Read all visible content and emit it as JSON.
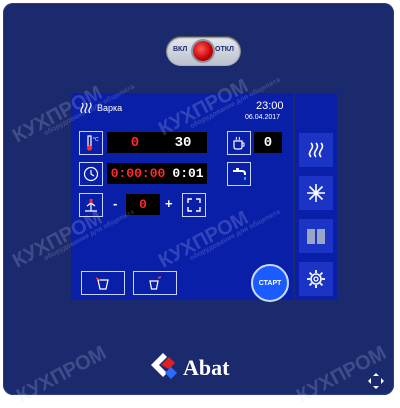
{
  "power": {
    "on_label": "ВКЛ",
    "off_label": "ОТКЛ"
  },
  "header": {
    "mode_label": "Варка",
    "time": "23:00",
    "date": "06.04.2017"
  },
  "temperature": {
    "current": "0",
    "target": "30"
  },
  "humidity": {
    "value": "0"
  },
  "timer": {
    "elapsed": "0:00:00",
    "set": "0:01"
  },
  "fan": {
    "minus": "-",
    "value": "0",
    "plus": "+"
  },
  "start_button": {
    "label": "СТАРТ"
  },
  "brand": {
    "name": "Abat"
  },
  "watermark": {
    "text": "КУХПРОМ",
    "subtext": "оборудование для общепита"
  },
  "colors": {
    "panel": "#1a2a6c",
    "screen": "#0a1fa8",
    "value_red": "#ff2a2a",
    "start_button": "#1a5cff"
  }
}
